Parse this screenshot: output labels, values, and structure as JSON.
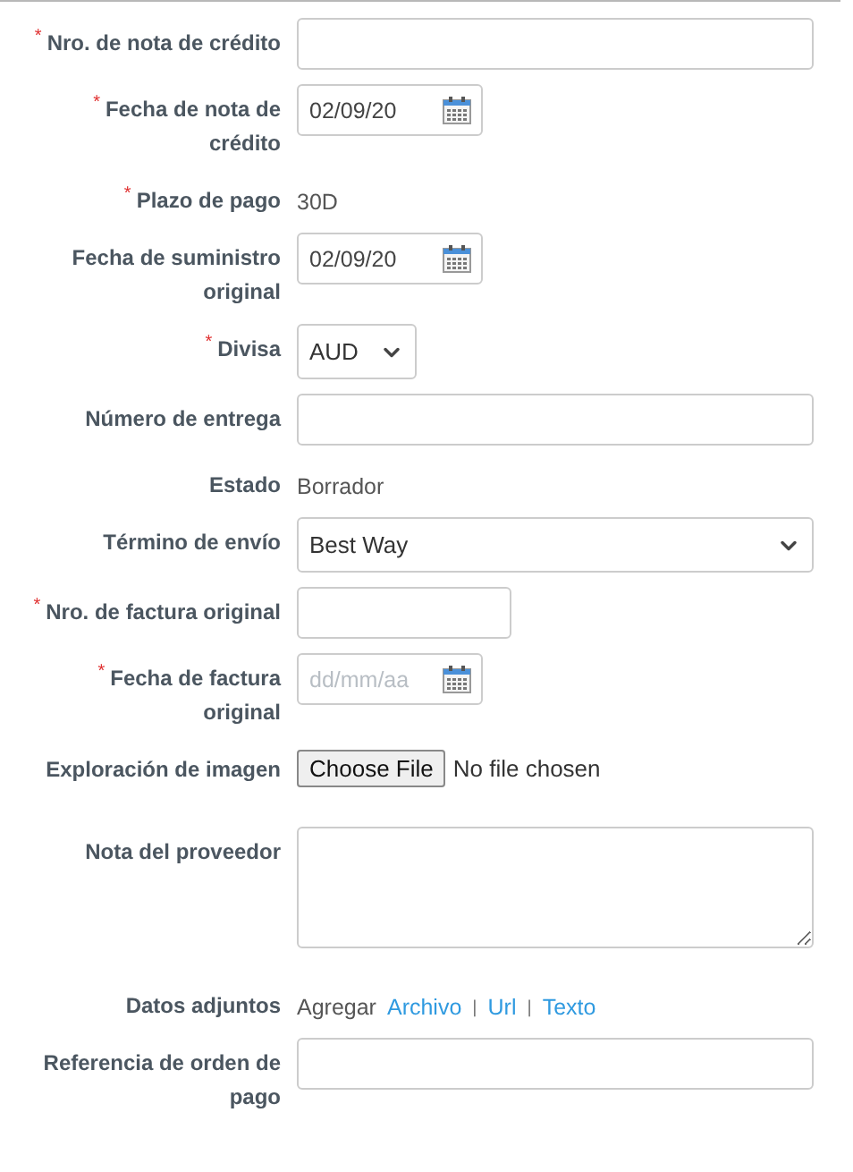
{
  "required_marker": "*",
  "fields": [
    {
      "label": "Nro. de nota de crédito",
      "required": true,
      "kind": "text"
    },
    {
      "label": "Fecha de nota de crédito",
      "required": true,
      "kind": "date",
      "value": "02/09/20"
    },
    {
      "label": "Plazo de pago",
      "required": true,
      "kind": "static",
      "value": "30D"
    },
    {
      "label": "Fecha de suministro original",
      "required": false,
      "kind": "date",
      "value": "02/09/20"
    },
    {
      "label": "Divisa",
      "required": true,
      "kind": "currency",
      "value": "AUD"
    },
    {
      "label": "Número de entrega",
      "required": false,
      "kind": "text"
    },
    {
      "label": "Estado",
      "required": false,
      "kind": "static",
      "value": "Borrador"
    },
    {
      "label": "Término de envío",
      "required": false,
      "kind": "select",
      "value": "Best Way"
    },
    {
      "label": "Nro. de factura original",
      "required": true,
      "kind": "code"
    },
    {
      "label": "Fecha de factura original",
      "required": true,
      "kind": "date",
      "placeholder": "dd/mm/aa"
    },
    {
      "label": "Exploración de imagen",
      "required": false,
      "kind": "file",
      "button": "Choose File",
      "status": "No file chosen"
    },
    {
      "label": "Nota del proveedor",
      "required": false,
      "kind": "textarea"
    },
    {
      "label": "Datos adjuntos",
      "required": false,
      "kind": "attachments",
      "prefix": "Agregar",
      "separator": "|",
      "links": [
        "Archivo",
        "Url",
        "Texto"
      ]
    },
    {
      "label": "Referencia de orden de pago",
      "required": false,
      "kind": "text"
    }
  ]
}
